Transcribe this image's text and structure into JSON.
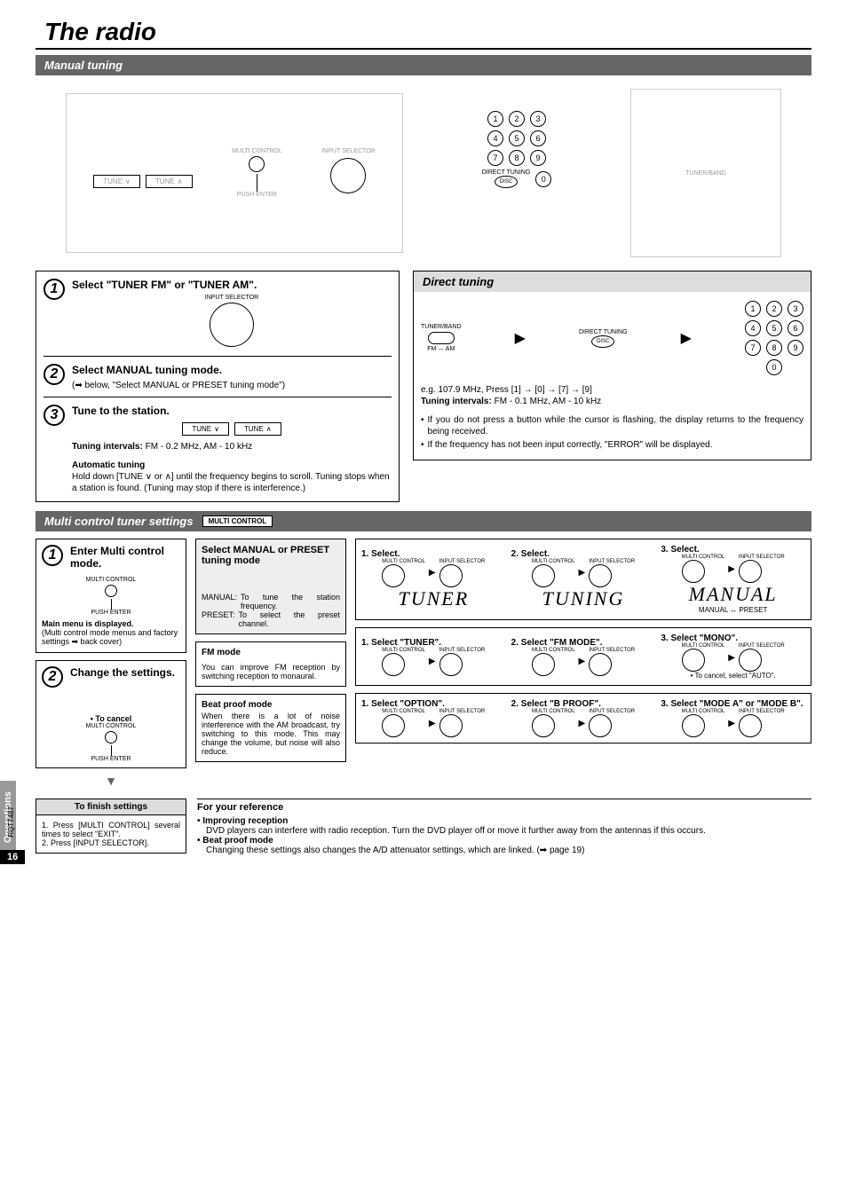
{
  "page_title": "The radio",
  "section_manual_tuning": "Manual tuning",
  "receiver_labels": {
    "tune_down": "TUNE",
    "tune_up": "TUNE",
    "multi_control": "MULTI CONTROL",
    "input_selector": "INPUT SELECTOR",
    "push_enter": "PUSH ENTER"
  },
  "keypad": {
    "direct_tuning_label": "DIRECT TUNING",
    "disc_label": "DISC",
    "tuner_band_label": "TUNER/BAND",
    "numbers": [
      "1",
      "2",
      "3",
      "4",
      "5",
      "6",
      "7",
      "8",
      "9",
      "0"
    ]
  },
  "steps": {
    "s1_title": "Select \"TUNER FM\" or \"TUNER AM\".",
    "s1_label": "INPUT SELECTOR",
    "s2_title": "Select MANUAL tuning mode.",
    "s2_note": "(➡ below, \"Select MANUAL or PRESET tuning mode\")",
    "s3_title": "Tune to the station.",
    "s3_intervals_label": "Tuning intervals:",
    "s3_intervals_val": " FM - 0.2 MHz, AM - 10 kHz",
    "s3_auto_title": "Automatic tuning",
    "s3_auto_text": "Hold down [TUNE ∨ or ∧] until the frequency begins to scroll. Tuning stops when a station is found. (Tuning may stop if there is interference.)"
  },
  "direct_tuning": {
    "header": "Direct tuning",
    "tuner_band": "TUNER/BAND",
    "fm_am": "FM ↔ AM",
    "direct_tuning_label": "DIRECT TUNING",
    "disc": "DISC",
    "example": "e.g. 107.9 MHz, Press [1] → [0] → [7] → [9]",
    "intervals_label": "Tuning intervals:",
    "intervals_val": " FM - 0.1 MHz, AM - 10 kHz",
    "note1": "If you do not press a button while the cursor is flashing, the display returns to the frequency being received.",
    "note2": "If the frequency has not been input correctly, \"ERROR\" will be displayed."
  },
  "multi_settings": {
    "header": "Multi control tuner settings",
    "badge": "MULTI CONTROL",
    "step1_title": "Enter Multi control mode.",
    "step1_label1": "MULTI CONTROL",
    "step1_label2": "PUSH ENTER",
    "step1_note": "Main menu is displayed.",
    "step1_note2": "(Multi control mode menus and factory settings ➡ back cover)",
    "step2_title": "Change the settings.",
    "cancel_label": "• To cancel",
    "cancel_sub1": "MULTI CONTROL",
    "cancel_sub2": "PUSH ENTER"
  },
  "manual_preset": {
    "title": "Select MANUAL or PRESET tuning mode",
    "manual_label": "MANUAL:",
    "manual_text": "To tune the station frequency.",
    "preset_label": "PRESET:",
    "preset_text": "To select the preset channel.",
    "sel1": "1. Select.",
    "sel2": "2. Select.",
    "sel3": "3. Select.",
    "disp1": "TUNER",
    "disp2": "TUNING",
    "disp3": "MANUAL",
    "disp3_sub": "MANUAL ↔ PRESET",
    "knob_left": "MULTI CONTROL",
    "knob_right": "INPUT SELECTOR"
  },
  "fm_mode": {
    "title": "FM mode",
    "text": "You can improve FM reception by switching reception to monaural.",
    "sel1": "1. Select \"TUNER\".",
    "sel2": "2. Select \"FM MODE\".",
    "sel3": "3. Select \"MONO\".",
    "cancel": "• To cancel, select \"AUTO\"."
  },
  "beat_proof": {
    "title": "Beat proof mode",
    "text": "When there is a lot of noise interference with the AM broadcast, try switching to this mode. This may change the volume, but noise will also reduce.",
    "sel1": "1. Select \"OPTION\".",
    "sel2": "2. Select \"B PROOF\".",
    "sel3": "3. Select \"MODE A\" or \"MODE B\"."
  },
  "finish": {
    "header": "To finish settings",
    "item1": "Press [MULTI CONTROL] several times to select \"EXIT\".",
    "item2": "Press [INPUT SELECTOR]."
  },
  "reference": {
    "title": "For your reference",
    "improving_title": "• Improving reception",
    "improving_text": "DVD players can interfere with radio reception. Turn the DVD player off or move it further away from the antennas if this occurs.",
    "beat_title": "• Beat proof mode",
    "beat_text": "Changing these settings also changes the A/D attenuator settings, which are linked. (➡ page 19)"
  },
  "side_tab": "Operations",
  "rqt": "RQT7487",
  "page_num": "16"
}
